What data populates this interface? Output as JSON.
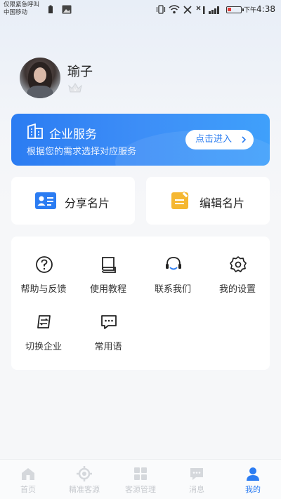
{
  "status_bar": {
    "carrier_line1": "仅限紧急呼叫",
    "carrier_line2": "中国移动",
    "ampm": "下午",
    "time": "4:38",
    "battery_color": "#e53935"
  },
  "profile": {
    "name": "瑜子",
    "badge_icon": "crown-icon"
  },
  "banner": {
    "title": "企业服务",
    "subtitle": "根据您的需求选择对应服务",
    "button_label": "点击进入",
    "accent": "#2b7cf2"
  },
  "cards": {
    "share_label": "分享名片",
    "edit_label": "编辑名片"
  },
  "tools": [
    {
      "label": "帮助与反馈",
      "icon": "question-circle-icon"
    },
    {
      "label": "使用教程",
      "icon": "book-icon"
    },
    {
      "label": "联系我们",
      "icon": "headset-icon"
    },
    {
      "label": "我的设置",
      "icon": "gear-icon"
    },
    {
      "label": "切换企业",
      "icon": "switch-icon"
    },
    {
      "label": "常用语",
      "icon": "chat-bubble-icon"
    }
  ],
  "tabbar": [
    {
      "label": "首页",
      "icon": "home-icon",
      "active": false
    },
    {
      "label": "精准客源",
      "icon": "target-icon",
      "active": false
    },
    {
      "label": "客源管理",
      "icon": "grid-icon",
      "active": false
    },
    {
      "label": "消息",
      "icon": "message-icon",
      "active": false
    },
    {
      "label": "我的",
      "icon": "person-icon",
      "active": true
    }
  ],
  "colors": {
    "accent": "#2b7cf2",
    "edit_icon": "#f5b731",
    "share_icon": "#2b7cf2"
  }
}
